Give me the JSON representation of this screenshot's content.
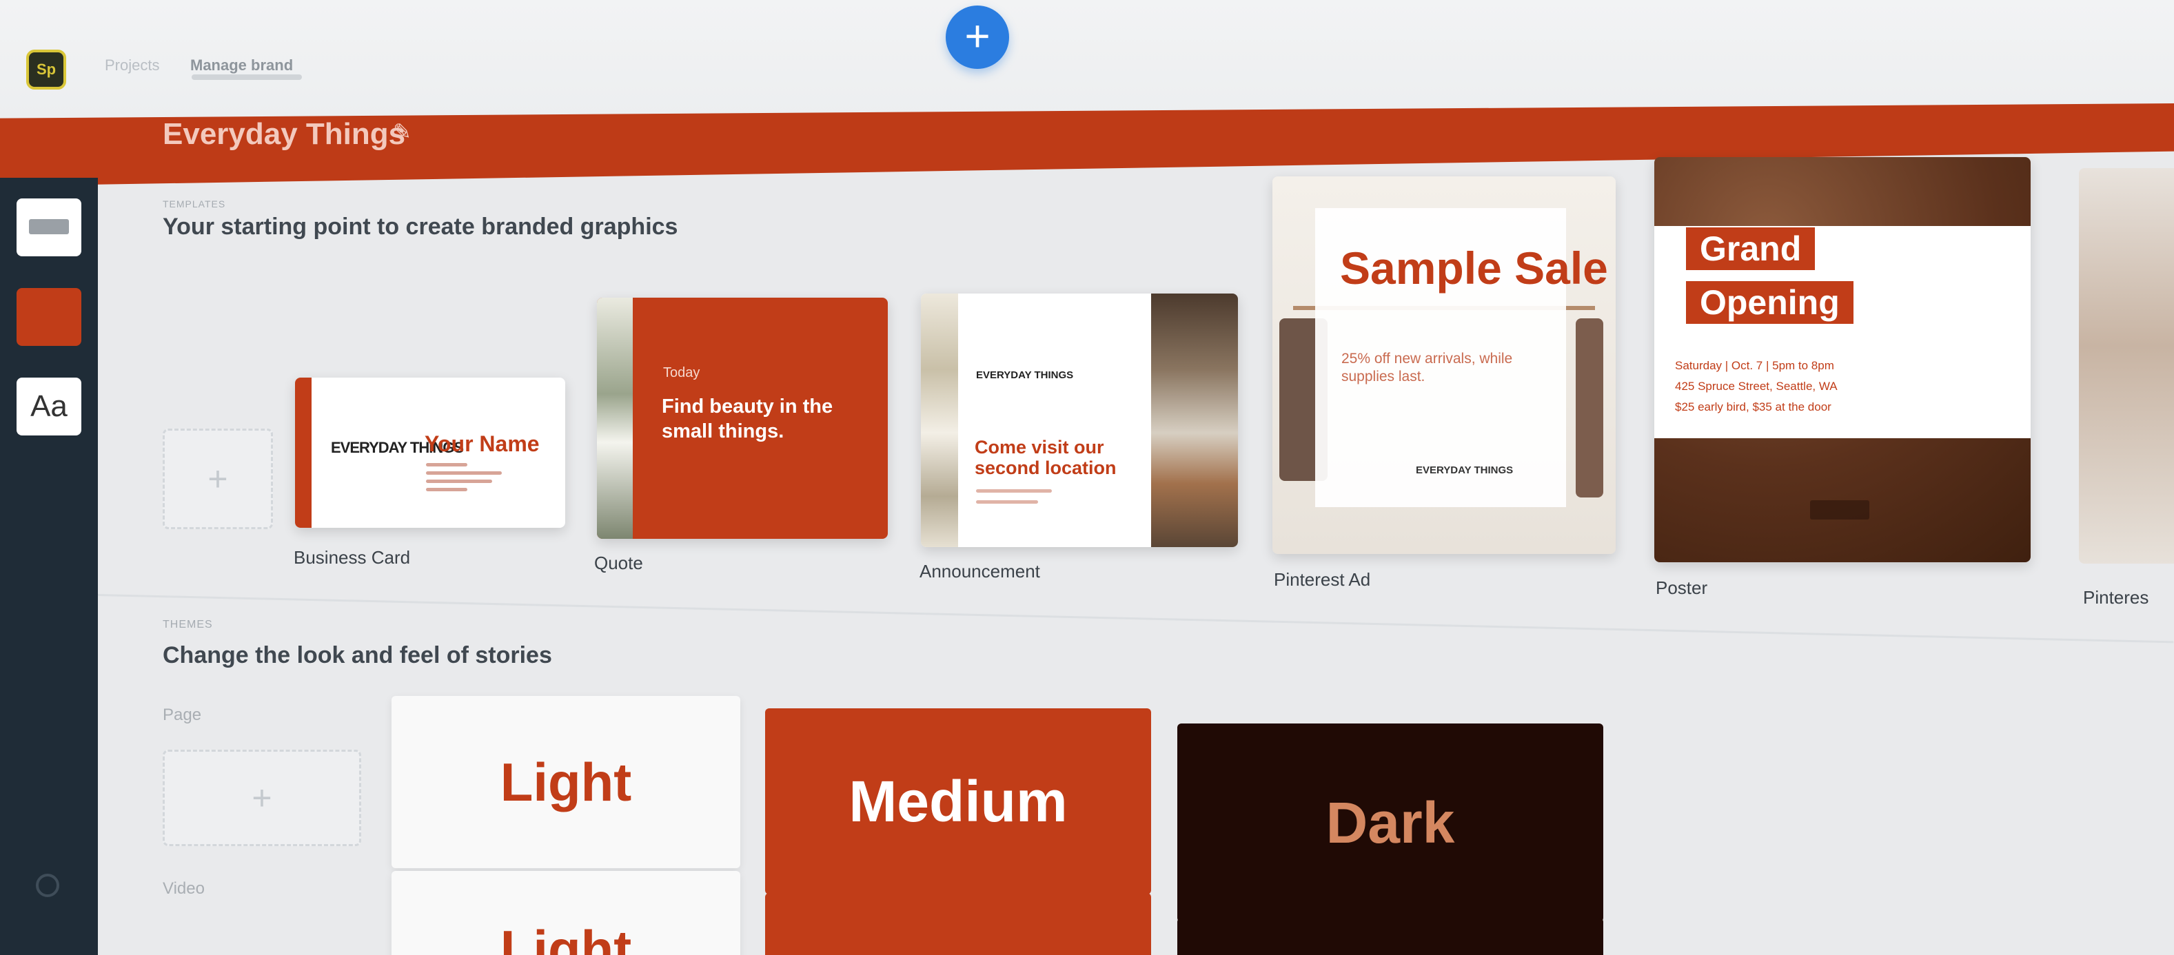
{
  "header": {
    "breadcrumb": {
      "parent": "Projects",
      "current": "Manage brand"
    },
    "brand_name": "Everyday Things",
    "icons": {
      "app_logo": "app-logo-icon",
      "add": "plus-icon",
      "edit": "pencil-icon"
    }
  },
  "sidebar": {
    "items": [
      {
        "name": "logo",
        "icon": "logo-thumbnail-icon"
      },
      {
        "name": "color",
        "icon": "color-swatch-icon",
        "color": "#c13d18"
      },
      {
        "name": "typography",
        "label": "Aa"
      }
    ]
  },
  "templates": {
    "section_label": "TEMPLATES",
    "title": "Your starting point to create branded graphics",
    "items": [
      {
        "label": "Business Card",
        "brand_mark": "EVERYDAY THINGS",
        "headline": "Your Name"
      },
      {
        "label": "Quote",
        "kicker": "Today",
        "headline": "Find beauty in the small things."
      },
      {
        "label": "Announcement",
        "brand_mark": "EVERYDAY THINGS",
        "headline": "Come visit our second location"
      },
      {
        "label": "Pinterest Ad",
        "headline": "Sample Sale",
        "subtext": "25% off new arrivals, while supplies last.",
        "brand_mark": "EVERYDAY THINGS"
      },
      {
        "label": "Poster",
        "headline_1": "Grand",
        "headline_2": "Opening",
        "details": [
          "Saturday | Oct. 7 | 5pm to 8pm",
          "425 Spruce Street, Seattle, WA",
          "$25 early bird, $35 at the door"
        ]
      },
      {
        "label": "Pinteres"
      }
    ]
  },
  "themes": {
    "section_label": "THEMES",
    "title": "Change the look and feel of stories",
    "rows": [
      {
        "label": "Page",
        "options": [
          "Light",
          "Medium",
          "Dark"
        ]
      },
      {
        "label": "Video",
        "options": [
          "Light"
        ]
      }
    ]
  },
  "colors": {
    "brand": "#c13d18",
    "sidebar": "#1f2c37",
    "accent_button": "#2b7de0",
    "dark_theme": "#200a05"
  }
}
